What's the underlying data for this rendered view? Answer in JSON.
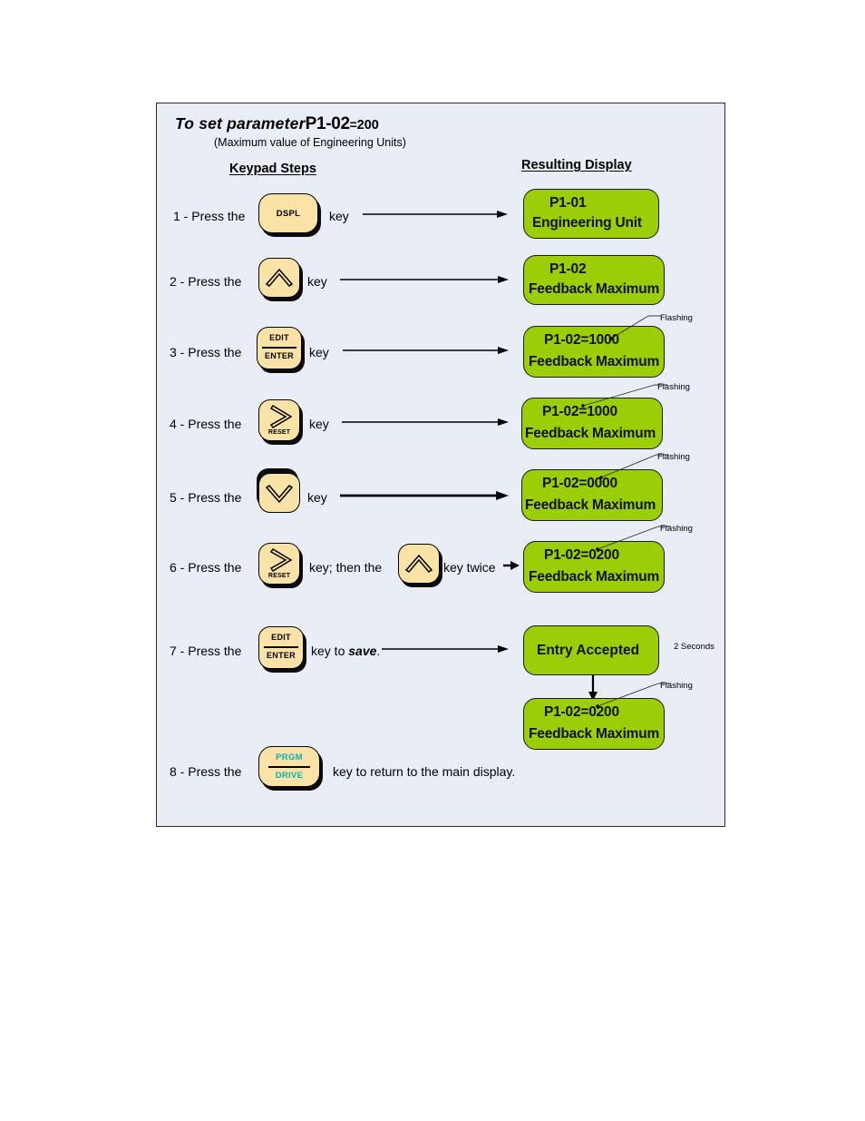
{
  "panel": {
    "background_color": "#E8EDF6",
    "border_color": "#2B2B2B"
  },
  "title": {
    "lead": "To set  parameter",
    "parameter": "P1-02",
    "equals": "=",
    "value": "200",
    "subtitle": "(Maximum  value of Engineering Units)"
  },
  "headers": {
    "keypad": "Keypad Steps",
    "display": "Resulting Display"
  },
  "colors": {
    "key_face": "#FBE3A8",
    "key_shadow": "#0B0B0B",
    "display_green": "#9BCE07",
    "prgm_text": "#09B2B2"
  },
  "keys": {
    "dspl": {
      "label": "DSPL",
      "icon": "dspl-key"
    },
    "up": {
      "label": "",
      "icon": "up-chevron-icon"
    },
    "down": {
      "label": "",
      "icon": "down-chevron-icon"
    },
    "right_reset": {
      "label": "RESET",
      "icon": "right-chevron-icon"
    },
    "edit_enter": {
      "top": "EDIT",
      "bottom": "ENTER",
      "icon": "edit-enter-key"
    },
    "prgm_drive": {
      "top": "PRGM",
      "bottom": "DRIVE",
      "icon": "prgm-drive-key"
    }
  },
  "steps": [
    {
      "number": "1",
      "prefix": "1 - Press the",
      "key": "dspl",
      "suffix": "key",
      "display": {
        "line1": "P1-01",
        "line2": "Engineering Unit"
      },
      "flashing": null
    },
    {
      "number": "2",
      "prefix": "2 - Press the",
      "key": "up",
      "suffix": "key",
      "display": {
        "line1": "P1-02",
        "line2": "Feedback Maximum"
      },
      "flashing": null
    },
    {
      "number": "3",
      "prefix": "3 - Press the",
      "key": "edit_enter",
      "suffix": "key",
      "display": {
        "line1": "P1-02=1000",
        "line2": "Feedback Maximum"
      },
      "flashing": "Flashing"
    },
    {
      "number": "4",
      "prefix": "4 - Press the",
      "key": "right_reset",
      "suffix": "key",
      "display": {
        "line1": "P1-02=1000",
        "line2": "Feedback Maximum"
      },
      "flashing": "Flashing"
    },
    {
      "number": "5",
      "prefix": "5 - Press the",
      "key": "down",
      "suffix": "key",
      "display": {
        "line1": "P1-02=0000",
        "line2": "Feedback Maximum"
      },
      "flashing": "Flashing"
    },
    {
      "number": "6",
      "prefix": "6 - Press the",
      "key": "right_reset",
      "middle": "key; then the",
      "key2": "up",
      "suffix": "key twice",
      "display": {
        "line1": "P1-02=0200",
        "line2": "Feedback Maximum"
      },
      "flashing": "Flashing"
    },
    {
      "number": "7",
      "prefix": "7 - Press the",
      "key": "edit_enter",
      "suffix_pre": "key to ",
      "suffix_em": "save",
      "suffix_post": ".",
      "display": {
        "single": "Entry Accepted"
      },
      "timer": "2 Seconds",
      "display2": {
        "line1": "P1-02=0200",
        "line2": "Feedback Maximum"
      },
      "flashing": "Flashing"
    },
    {
      "number": "8",
      "prefix": "8 - Press the",
      "key": "prgm_drive",
      "suffix": "key to return to the main display."
    }
  ]
}
